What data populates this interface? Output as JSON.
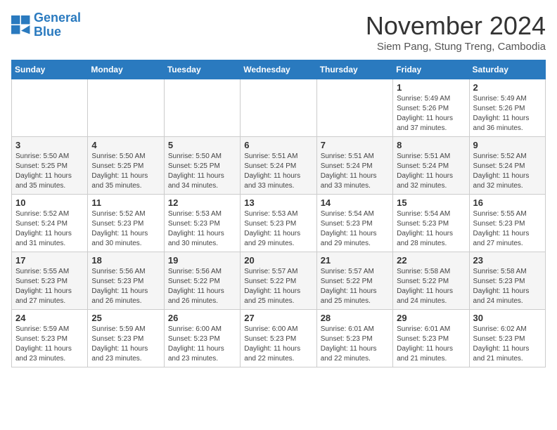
{
  "logo": {
    "line1": "General",
    "line2": "Blue"
  },
  "title": "November 2024",
  "subtitle": "Siem Pang, Stung Treng, Cambodia",
  "days_of_week": [
    "Sunday",
    "Monday",
    "Tuesday",
    "Wednesday",
    "Thursday",
    "Friday",
    "Saturday"
  ],
  "weeks": [
    [
      {
        "day": "",
        "info": ""
      },
      {
        "day": "",
        "info": ""
      },
      {
        "day": "",
        "info": ""
      },
      {
        "day": "",
        "info": ""
      },
      {
        "day": "",
        "info": ""
      },
      {
        "day": "1",
        "info": "Sunrise: 5:49 AM\nSunset: 5:26 PM\nDaylight: 11 hours and 37 minutes."
      },
      {
        "day": "2",
        "info": "Sunrise: 5:49 AM\nSunset: 5:26 PM\nDaylight: 11 hours and 36 minutes."
      }
    ],
    [
      {
        "day": "3",
        "info": "Sunrise: 5:50 AM\nSunset: 5:25 PM\nDaylight: 11 hours and 35 minutes."
      },
      {
        "day": "4",
        "info": "Sunrise: 5:50 AM\nSunset: 5:25 PM\nDaylight: 11 hours and 35 minutes."
      },
      {
        "day": "5",
        "info": "Sunrise: 5:50 AM\nSunset: 5:25 PM\nDaylight: 11 hours and 34 minutes."
      },
      {
        "day": "6",
        "info": "Sunrise: 5:51 AM\nSunset: 5:24 PM\nDaylight: 11 hours and 33 minutes."
      },
      {
        "day": "7",
        "info": "Sunrise: 5:51 AM\nSunset: 5:24 PM\nDaylight: 11 hours and 33 minutes."
      },
      {
        "day": "8",
        "info": "Sunrise: 5:51 AM\nSunset: 5:24 PM\nDaylight: 11 hours and 32 minutes."
      },
      {
        "day": "9",
        "info": "Sunrise: 5:52 AM\nSunset: 5:24 PM\nDaylight: 11 hours and 32 minutes."
      }
    ],
    [
      {
        "day": "10",
        "info": "Sunrise: 5:52 AM\nSunset: 5:24 PM\nDaylight: 11 hours and 31 minutes."
      },
      {
        "day": "11",
        "info": "Sunrise: 5:52 AM\nSunset: 5:23 PM\nDaylight: 11 hours and 30 minutes."
      },
      {
        "day": "12",
        "info": "Sunrise: 5:53 AM\nSunset: 5:23 PM\nDaylight: 11 hours and 30 minutes."
      },
      {
        "day": "13",
        "info": "Sunrise: 5:53 AM\nSunset: 5:23 PM\nDaylight: 11 hours and 29 minutes."
      },
      {
        "day": "14",
        "info": "Sunrise: 5:54 AM\nSunset: 5:23 PM\nDaylight: 11 hours and 29 minutes."
      },
      {
        "day": "15",
        "info": "Sunrise: 5:54 AM\nSunset: 5:23 PM\nDaylight: 11 hours and 28 minutes."
      },
      {
        "day": "16",
        "info": "Sunrise: 5:55 AM\nSunset: 5:23 PM\nDaylight: 11 hours and 27 minutes."
      }
    ],
    [
      {
        "day": "17",
        "info": "Sunrise: 5:55 AM\nSunset: 5:23 PM\nDaylight: 11 hours and 27 minutes."
      },
      {
        "day": "18",
        "info": "Sunrise: 5:56 AM\nSunset: 5:23 PM\nDaylight: 11 hours and 26 minutes."
      },
      {
        "day": "19",
        "info": "Sunrise: 5:56 AM\nSunset: 5:22 PM\nDaylight: 11 hours and 26 minutes."
      },
      {
        "day": "20",
        "info": "Sunrise: 5:57 AM\nSunset: 5:22 PM\nDaylight: 11 hours and 25 minutes."
      },
      {
        "day": "21",
        "info": "Sunrise: 5:57 AM\nSunset: 5:22 PM\nDaylight: 11 hours and 25 minutes."
      },
      {
        "day": "22",
        "info": "Sunrise: 5:58 AM\nSunset: 5:22 PM\nDaylight: 11 hours and 24 minutes."
      },
      {
        "day": "23",
        "info": "Sunrise: 5:58 AM\nSunset: 5:23 PM\nDaylight: 11 hours and 24 minutes."
      }
    ],
    [
      {
        "day": "24",
        "info": "Sunrise: 5:59 AM\nSunset: 5:23 PM\nDaylight: 11 hours and 23 minutes."
      },
      {
        "day": "25",
        "info": "Sunrise: 5:59 AM\nSunset: 5:23 PM\nDaylight: 11 hours and 23 minutes."
      },
      {
        "day": "26",
        "info": "Sunrise: 6:00 AM\nSunset: 5:23 PM\nDaylight: 11 hours and 23 minutes."
      },
      {
        "day": "27",
        "info": "Sunrise: 6:00 AM\nSunset: 5:23 PM\nDaylight: 11 hours and 22 minutes."
      },
      {
        "day": "28",
        "info": "Sunrise: 6:01 AM\nSunset: 5:23 PM\nDaylight: 11 hours and 22 minutes."
      },
      {
        "day": "29",
        "info": "Sunrise: 6:01 AM\nSunset: 5:23 PM\nDaylight: 11 hours and 21 minutes."
      },
      {
        "day": "30",
        "info": "Sunrise: 6:02 AM\nSunset: 5:23 PM\nDaylight: 11 hours and 21 minutes."
      }
    ]
  ]
}
